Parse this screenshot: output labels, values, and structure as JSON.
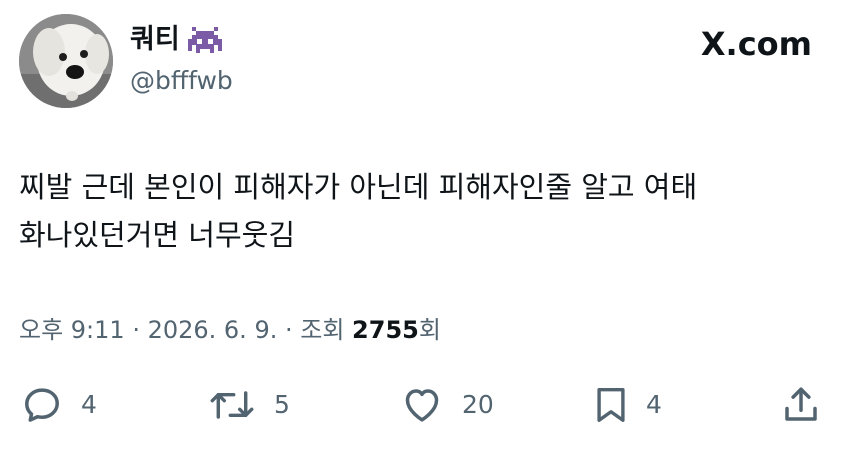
{
  "author": {
    "display_name": "쿼티",
    "emoji": "alien-monster-icon",
    "handle": "@bfffwb"
  },
  "brand": {
    "label": "X.com"
  },
  "tweet": {
    "text": "찌발 근데 본인이 피해자가 아닌데 피해자인줄 알고 여태 화나있던거면 너무웃김"
  },
  "meta": {
    "time": "오후 9:11",
    "separator1": " · ",
    "date": "2026. 6. 9.",
    "separator2": " · ",
    "views_label": "조회",
    "views_count": "2755",
    "views_suffix": "회"
  },
  "actions": {
    "reply": {
      "icon": "reply-icon",
      "count": "4"
    },
    "retweet": {
      "icon": "retweet-icon",
      "count": "5"
    },
    "like": {
      "icon": "like-icon",
      "count": "20"
    },
    "bookmark": {
      "icon": "bookmark-icon",
      "count": "4"
    },
    "share": {
      "icon": "share-icon"
    }
  },
  "colors": {
    "text": "#0f1419",
    "secondary": "#536471",
    "emoji": "#7b5aa6"
  }
}
